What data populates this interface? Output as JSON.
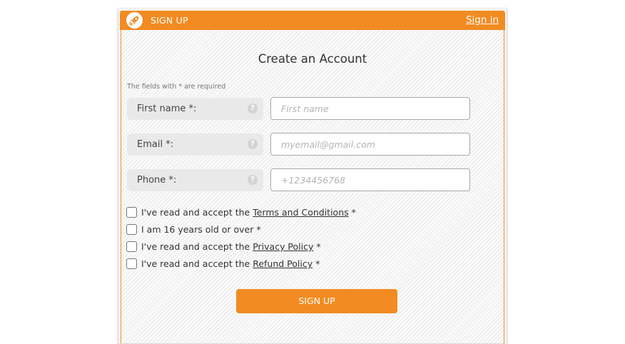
{
  "header": {
    "title": "SIGN UP",
    "signin_link": "Sign in",
    "logo_icon": "rocket-logo-icon"
  },
  "form": {
    "title": "Create an Account",
    "required_note": "The fields with * are required",
    "fields": [
      {
        "label": "First name *:",
        "placeholder": "First name",
        "help_icon": "question-icon"
      },
      {
        "label": "Email *:",
        "placeholder": "myemail@gmail.com",
        "help_icon": "question-icon"
      },
      {
        "label": "Phone *:",
        "placeholder": "+1234456768",
        "help_icon": "question-icon"
      }
    ],
    "checkboxes": [
      {
        "prefix": "I've read and accept the ",
        "link": "Terms and Conditions",
        "suffix": " *",
        "checked": false
      },
      {
        "prefix": "I am 16 years old or over *",
        "link": "",
        "suffix": "",
        "checked": false
      },
      {
        "prefix": "I've read and accept the ",
        "link": "Privacy Policy",
        "suffix": " *",
        "checked": false
      },
      {
        "prefix": "I've read and accept the ",
        "link": "Refund Policy",
        "suffix": " *",
        "checked": false
      }
    ],
    "submit_label": "SIGN UP"
  },
  "colors": {
    "accent": "#f28b22",
    "label_bg": "#e9e9e9",
    "input_border": "#a9a9a9"
  }
}
